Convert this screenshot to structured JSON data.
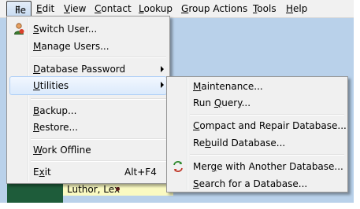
{
  "menubar": {
    "items": [
      "File",
      "Edit",
      "View",
      "Contact",
      "Lookup",
      "Group Actions",
      "Tools",
      "Help"
    ],
    "mnemonics": [
      "F",
      "E",
      "V",
      "C",
      "L",
      "G",
      "T",
      "H"
    ],
    "rest": [
      "ile",
      "dit",
      "iew",
      "ontact",
      "ookup",
      "roup Actions",
      "ools",
      "elp"
    ]
  },
  "file_menu": {
    "items": [
      {
        "label": "Switch User...",
        "mnemonic": "S",
        "rest": "witch User...",
        "icon": "user-icon"
      },
      {
        "label": "Manage Users...",
        "mnemonic": "M",
        "rest": "anage Users..."
      },
      {
        "label": "Database Password",
        "mnemonic": "D",
        "rest": "atabase Password",
        "submenu": true
      },
      {
        "label": "Utilities",
        "mnemonic": "U",
        "rest": "tilities",
        "submenu": true,
        "highlighted": true
      },
      {
        "label": "Backup...",
        "mnemonic": "B",
        "rest": "ackup..."
      },
      {
        "label": "Restore...",
        "mnemonic": "R",
        "rest": "estore..."
      },
      {
        "label": "Work Offline",
        "mnemonic": "W",
        "rest": "ork Offline"
      },
      {
        "label": "Exit",
        "mnemonic": "x",
        "pre": "E",
        "rest": "it",
        "shortcut": "Alt+F4"
      }
    ]
  },
  "utilities_menu": {
    "items": [
      {
        "label": "Maintenance...",
        "mnemonic": "M",
        "rest": "aintenance..."
      },
      {
        "label": "Run Query...",
        "mnemonic": "Q",
        "pre": "Run ",
        "rest": "uery..."
      },
      {
        "label": "Compact and Repair Database...",
        "mnemonic": "C",
        "rest": "ompact and Repair Database..."
      },
      {
        "label": "Rebuild Database...",
        "mnemonic": "b",
        "pre": "Re",
        "rest": "uild Database..."
      },
      {
        "label": "Merge with Another Database...",
        "mnemonic": "g",
        "pre": "Mer",
        "rest": "e with Another Database...",
        "icon": "merge-icon"
      },
      {
        "label": "Search for a Database...",
        "mnemonic": "S",
        "rest": "earch for a Database..."
      }
    ]
  },
  "background": {
    "contact_name": "Luthor, Lex"
  }
}
